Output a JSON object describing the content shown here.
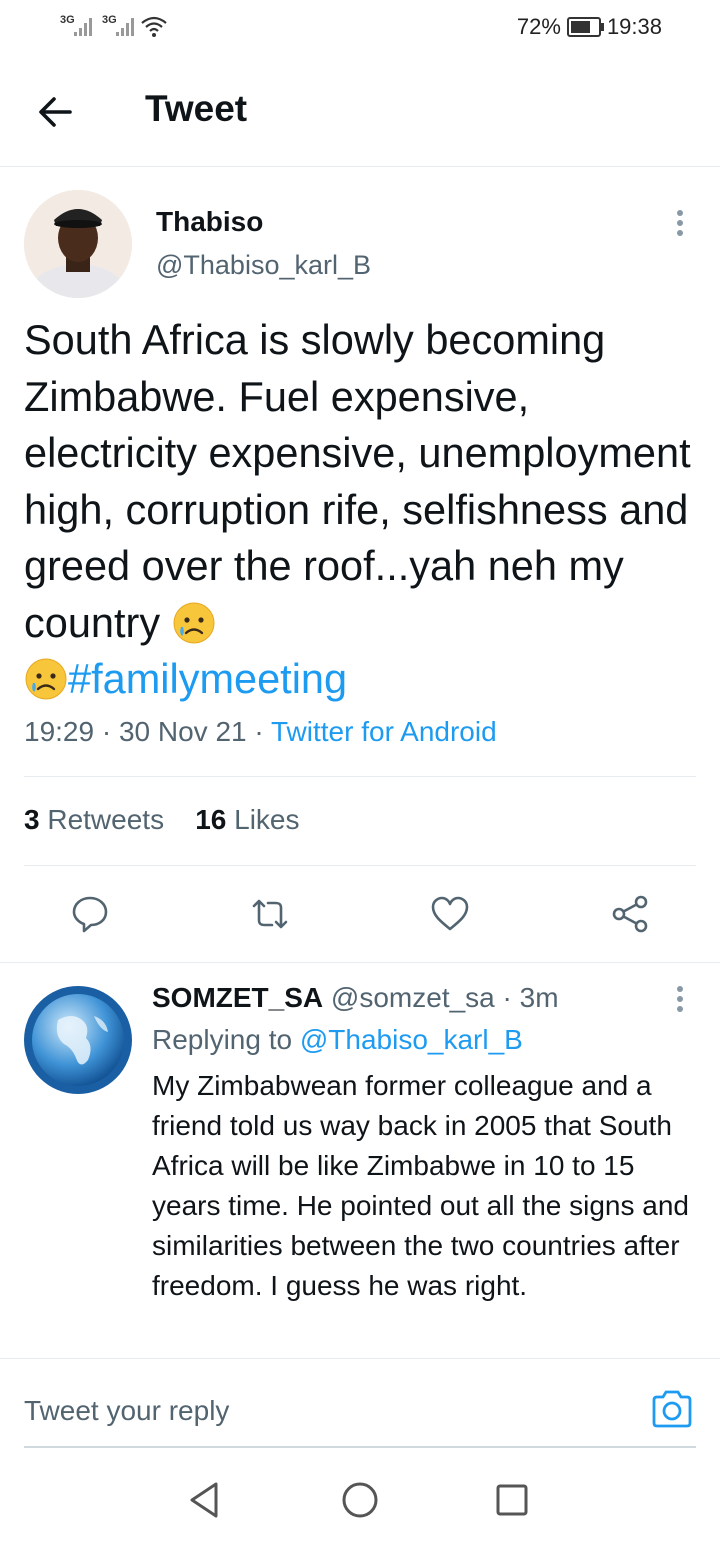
{
  "status_bar": {
    "signal1": "3G",
    "signal2": "3G",
    "battery_percent": "72%",
    "battery_level": 0.72,
    "time": "19:38"
  },
  "header": {
    "title": "Tweet",
    "back_icon": "arrow-left-icon"
  },
  "tweet": {
    "author_name": "Thabiso",
    "author_handle": "@Thabiso_karl_B",
    "text_main": "South Africa is slowly becoming Zimbabwe.  Fuel expensive, electricity expensive, unemployment high, corruption rife, selfishness and greed over the roof...yah neh my country ",
    "emoji": "sad-but-relieved-face-icon",
    "hashtag": "#familymeeting",
    "time": "19:29",
    "separator": "·",
    "date": "30 Nov 21",
    "source": "Twitter for Android",
    "retweets_count": "3",
    "retweets_label": "Retweets",
    "likes_count": "16",
    "likes_label": "Likes"
  },
  "actions": [
    "reply-icon",
    "retweet-icon",
    "like-icon",
    "share-icon"
  ],
  "reply": {
    "author_name": "SOMZET_SA",
    "author_handle": "@somzet_sa",
    "separator": "·",
    "time_ago": "3m",
    "replying_label": "Replying to",
    "replying_to": "@Thabiso_karl_B",
    "text": "My Zimbabwean former colleague and a friend told us way back in 2005 that South Africa will be like Zimbabwe in 10 to 15 years time. He pointed out all the signs and similarities between the two countries after freedom. I guess he was right."
  },
  "composer": {
    "placeholder": "Tweet your reply",
    "camera_icon": "camera-icon"
  },
  "nav": [
    "back-triangle-icon",
    "home-circle-icon",
    "recents-square-icon"
  ],
  "colors": {
    "accent": "#1d9bf0",
    "secondary_text": "#536471",
    "divider": "#e6ecf0"
  }
}
